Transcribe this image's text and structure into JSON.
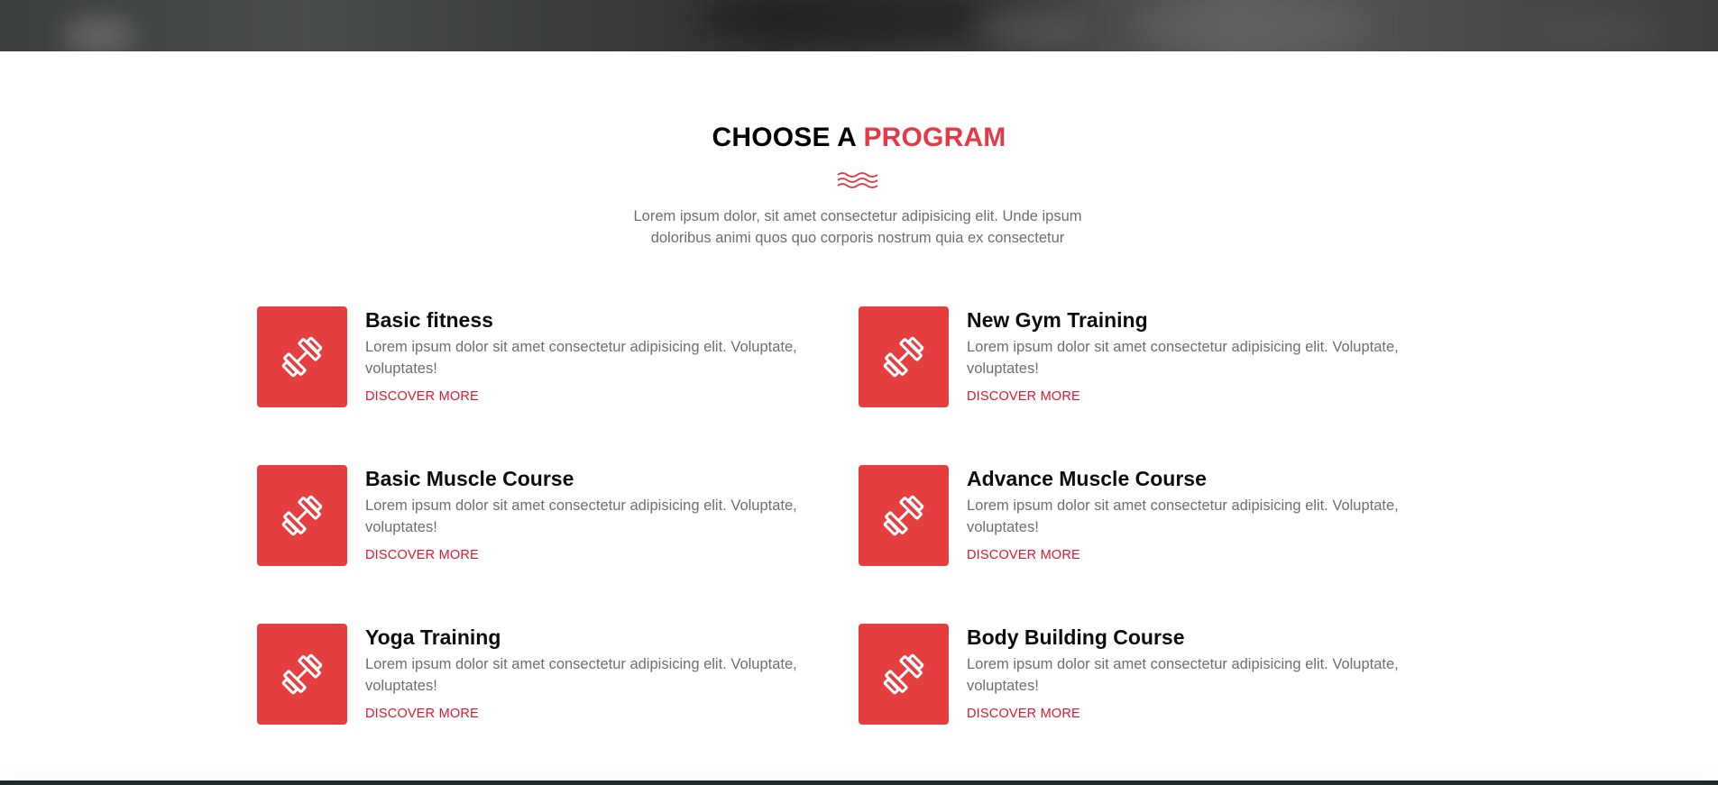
{
  "section": {
    "title_prefix": "CHOOSE A",
    "title_accent": "PROGRAM",
    "description": "Lorem ipsum dolor, sit amet consectetur adipisicing elit. Unde ipsum doloribus animi quos quo corporis nostrum quia ex consectetur"
  },
  "colors": {
    "accent": "#e53946",
    "icon_box": "#e53e3e",
    "link": "#e3172f",
    "text_muted": "#6b6f74"
  },
  "icons": {
    "divider": "wave-icon",
    "program": "dumbbell-icon"
  },
  "programs": [
    {
      "title": "Basic fitness",
      "description": "Lorem ipsum dolor sit amet consectetur adipisicing elit. Voluptate, voluptates!",
      "link": "DISCOVER MORE"
    },
    {
      "title": "New Gym Training",
      "description": "Lorem ipsum dolor sit amet consectetur adipisicing elit. Voluptate, voluptates!",
      "link": "DISCOVER MORE"
    },
    {
      "title": "Basic Muscle Course",
      "description": "Lorem ipsum dolor sit amet consectetur adipisicing elit. Voluptate, voluptates!",
      "link": "DISCOVER MORE"
    },
    {
      "title": "Advance Muscle Course",
      "description": "Lorem ipsum dolor sit amet consectetur adipisicing elit. Voluptate, voluptates!",
      "link": "DISCOVER MORE"
    },
    {
      "title": "Yoga Training",
      "description": "Lorem ipsum dolor sit amet consectetur adipisicing elit. Voluptate, voluptates!",
      "link": "DISCOVER MORE"
    },
    {
      "title": "Body Building Course",
      "description": "Lorem ipsum dolor sit amet consectetur adipisicing elit. Voluptate, voluptates!",
      "link": "DISCOVER MORE"
    }
  ]
}
